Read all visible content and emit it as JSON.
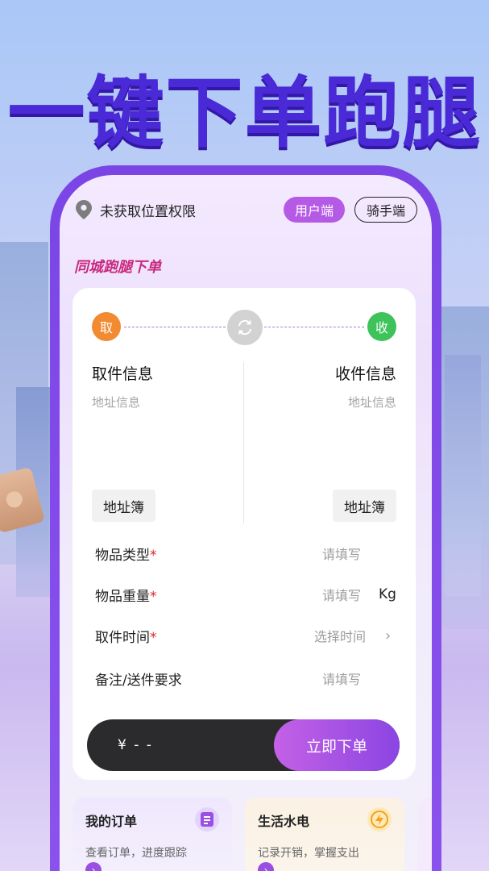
{
  "headline": "一键下单跑腿",
  "topbar": {
    "location_text": "未获取位置权限",
    "mode_user": "用户端",
    "mode_rider": "骑手端"
  },
  "section_title": "同城跑腿下单",
  "route": {
    "pick_badge": "取",
    "receive_badge": "收"
  },
  "pickup": {
    "title": "取件信息",
    "address_placeholder": "地址信息",
    "book_label": "地址簿"
  },
  "delivery": {
    "title": "收件信息",
    "address_placeholder": "地址信息",
    "book_label": "地址簿"
  },
  "form": {
    "item_type": {
      "label": "物品类型",
      "required": "*",
      "value": "请填写"
    },
    "item_weight": {
      "label": "物品重量",
      "required": "*",
      "value": "请填写",
      "unit": "Kg"
    },
    "pickup_time": {
      "label": "取件时间",
      "required": "*",
      "value": "选择时间",
      "chevron": "›"
    },
    "notes": {
      "label": "备注/送件要求",
      "value": "请填写"
    }
  },
  "order": {
    "price": "¥ - -",
    "submit_label": "立即下单"
  },
  "tiles": [
    {
      "title": "我的订单",
      "subtitle": "查看订单，进度跟踪",
      "icon": "document-icon",
      "go": "›"
    },
    {
      "title": "生活水电",
      "subtitle": "记录开销，掌握支出",
      "icon": "lightning-icon",
      "go": "›"
    }
  ],
  "colors": {
    "accent_purple": "#b55ae5",
    "headline": "#4a2ad6",
    "pick": "#f28a32",
    "receive": "#3ec25a",
    "required": "#d92626"
  }
}
